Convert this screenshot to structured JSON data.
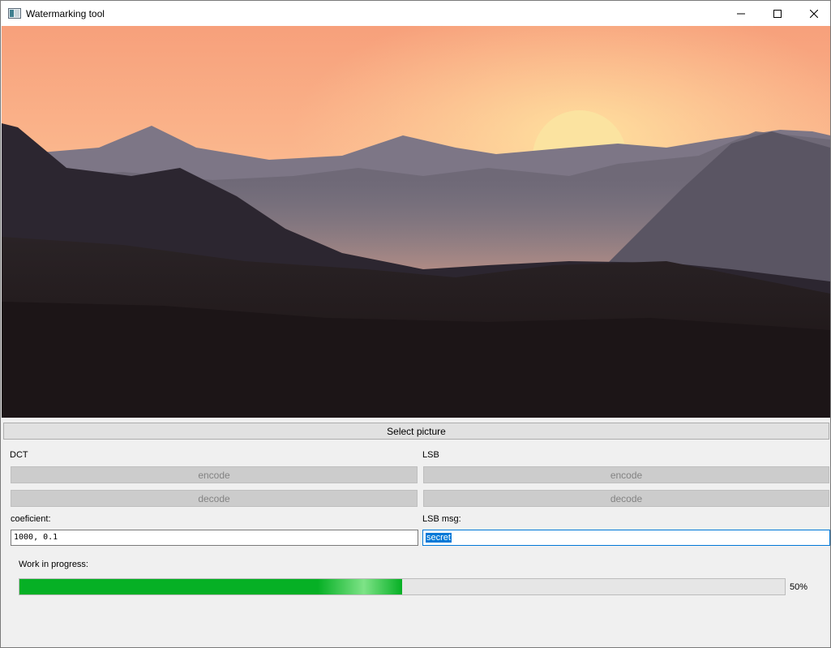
{
  "window": {
    "title": "Watermarking tool",
    "icon": "app-window-icon",
    "controls": [
      "minimize-icon",
      "maximize-icon",
      "close-icon"
    ]
  },
  "picture": {
    "content": "landscape-photo"
  },
  "select_button": "Select picture",
  "dct": {
    "label": "DCT",
    "encode_label": "encode",
    "decode_label": "decode",
    "param_label": "coeficient:",
    "param_value": "1000, 0.1"
  },
  "lsb": {
    "label": "LSB",
    "encode_label": "encode",
    "decode_label": "decode",
    "param_label": "LSB msg:",
    "param_value": "secret"
  },
  "progress": {
    "label": "Work in progress:",
    "value": 50,
    "text": "50%",
    "color": "#06b025"
  },
  "colors": {
    "accent": "#0078d7",
    "progress": "#06b025"
  }
}
